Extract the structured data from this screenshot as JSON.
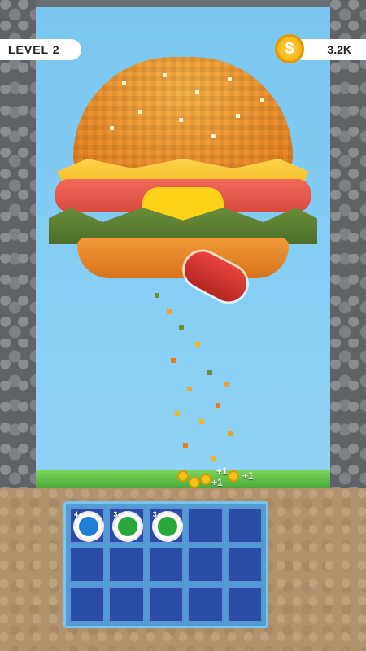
{
  "hud": {
    "level_label": "LEVEL  2",
    "coins": "3.2K",
    "coin_symbol": "$"
  },
  "popups": [
    "+1",
    "+1",
    "+1"
  ],
  "inventory": {
    "cells": [
      {
        "color": "#1f7fd6",
        "level": "4"
      },
      {
        "color": "#29a83a",
        "level": "3"
      },
      {
        "color": "#29a83a",
        "level": "3"
      }
    ]
  },
  "colors": {
    "sky": "#79c6f0",
    "grass": "#4aa83a",
    "grid_bg": "#4d9fd4",
    "cell_bg": "#2a4ea6"
  }
}
